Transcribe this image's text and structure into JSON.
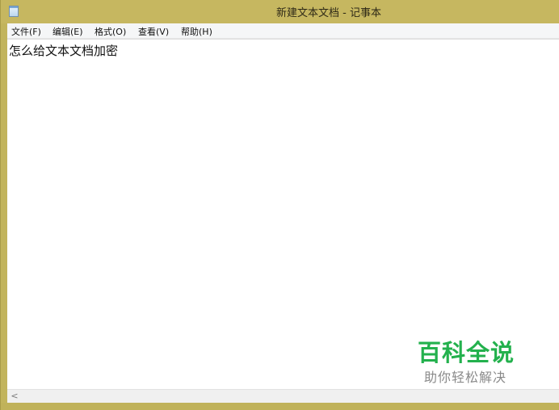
{
  "window": {
    "title": "新建文本文档 - 记事本"
  },
  "menu": {
    "file": "文件(F)",
    "edit": "编辑(E)",
    "format": "格式(O)",
    "view": "查看(V)",
    "help": "帮助(H)"
  },
  "editor": {
    "content": "怎么给文本文档加密"
  },
  "scrollbar": {
    "left_arrow": "<"
  },
  "watermark": {
    "brand": "百科全说",
    "slogan": "助你轻松解决"
  },
  "icons": {
    "app": "notepad-icon"
  },
  "colors": {
    "frame": "#c2b45c",
    "brand_green": "#23b14d"
  }
}
